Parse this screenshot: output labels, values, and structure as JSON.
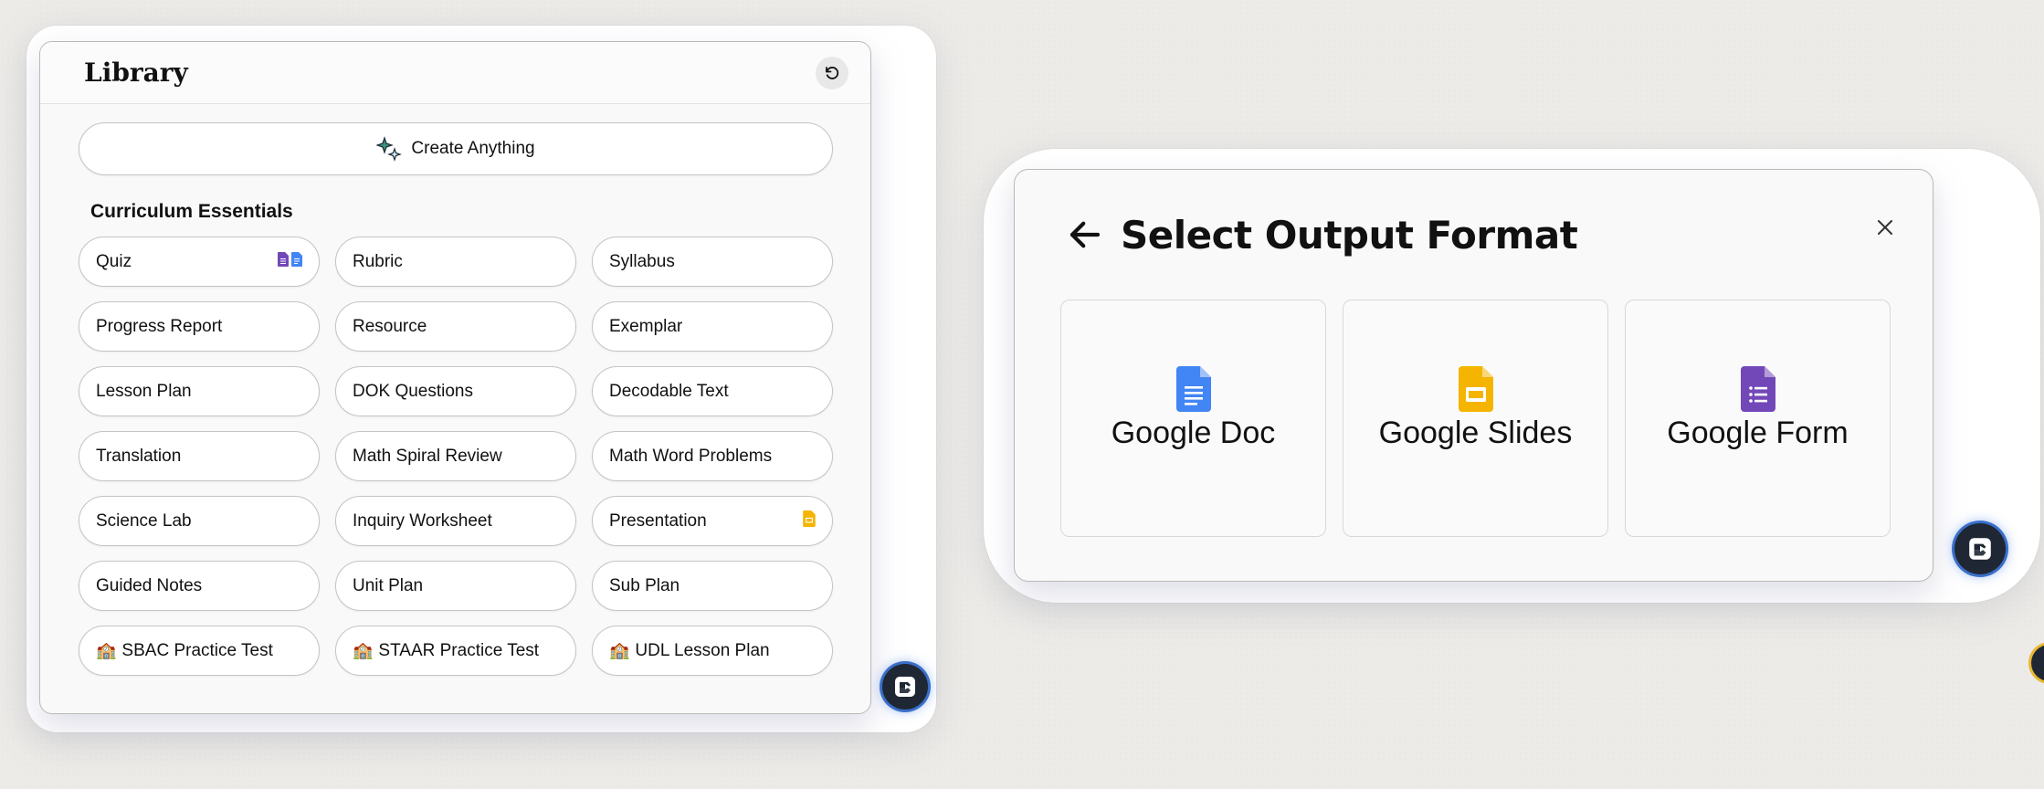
{
  "library": {
    "title": "Library",
    "create_label": "Create Anything",
    "section_title": "Curriculum Essentials",
    "items": [
      {
        "label": "Quiz",
        "icons": [
          "google-form-icon",
          "google-doc-icon"
        ]
      },
      {
        "label": "Rubric"
      },
      {
        "label": "Syllabus"
      },
      {
        "label": "Progress Report"
      },
      {
        "label": "Resource"
      },
      {
        "label": "Exemplar"
      },
      {
        "label": "Lesson Plan"
      },
      {
        "label": "DOK Questions"
      },
      {
        "label": "Decodable Text"
      },
      {
        "label": "Translation"
      },
      {
        "label": "Math Spiral Review"
      },
      {
        "label": "Math Word Problems"
      },
      {
        "label": "Science Lab"
      },
      {
        "label": "Inquiry Worksheet"
      },
      {
        "label": "Presentation",
        "icons": [
          "google-slides-icon"
        ]
      },
      {
        "label": "Guided Notes"
      },
      {
        "label": "Unit Plan"
      },
      {
        "label": "Sub Plan"
      },
      {
        "label": "SBAC Practice Test",
        "prefix": "🏫"
      },
      {
        "label": "STAAR Practice Test",
        "prefix": "🏫"
      },
      {
        "label": "UDL Lesson Plan",
        "prefix": "🏫"
      }
    ]
  },
  "output": {
    "title": "Select Output Format",
    "cards": [
      {
        "label": "Google Doc",
        "icon": "google-doc-icon",
        "color": "#4285f4"
      },
      {
        "label": "Google Slides",
        "icon": "google-slides-icon",
        "color": "#f4b400"
      },
      {
        "label": "Google Form",
        "icon": "google-form-icon",
        "color": "#7248b9"
      }
    ]
  },
  "colors": {
    "background": "#ecebe8",
    "panel": "#f9f9f9",
    "fab": "#1f2734",
    "fab_ring": "#3a6fc9"
  }
}
